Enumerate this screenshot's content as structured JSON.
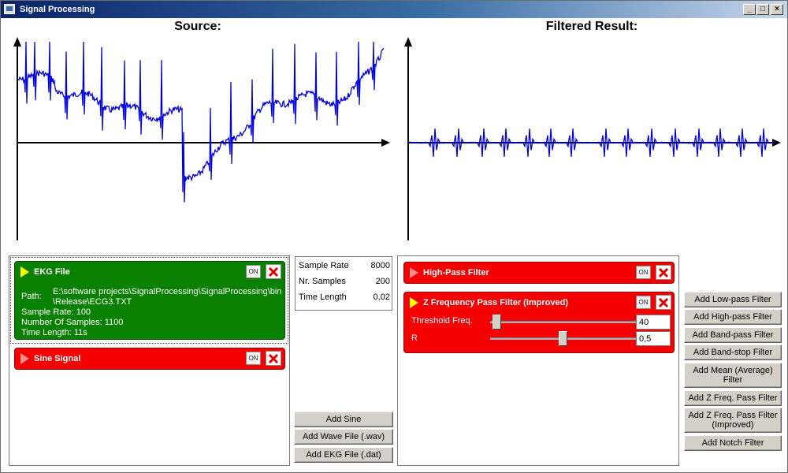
{
  "window": {
    "title": "Signal Processing",
    "minimize": "_",
    "maximize": "□",
    "close": "×"
  },
  "plots": {
    "source_title": "Source:",
    "result_title": "Filtered Result:"
  },
  "sources": [
    {
      "name": "EKG File",
      "state": "ON",
      "path_label": "Path:",
      "path_line1": "E:\\software projects\\SignalProcessing\\SignalProcessing\\bin",
      "path_line2": "\\Release\\ECG3.TXT",
      "sample_rate": "Sample Rate: 100",
      "num_samples": "Number Of Samples: 1100",
      "time_length": "Time Length: 11s",
      "color": "#0a8000"
    },
    {
      "name": "Sine Signal",
      "state": "ON",
      "color": "#f40000"
    }
  ],
  "stats": [
    {
      "label": "Sample Rate",
      "value": "8000"
    },
    {
      "label": "Nr. Samples",
      "value": "200"
    },
    {
      "label": "Time Length",
      "value": "0,02"
    }
  ],
  "source_buttons": [
    "Add Sine",
    "Add Wave File (.wav)",
    "Add EKG File (.dat)"
  ],
  "filters": [
    {
      "name": "High-Pass Filter",
      "state": "ON"
    },
    {
      "name": "Z Frequency Pass Filter (Improved)",
      "state": "ON",
      "params": [
        {
          "label": "Threshold Freq.",
          "value": "40",
          "slider_fraction": 0.02
        },
        {
          "label": "R",
          "value": "0,5",
          "slider_fraction": 0.5
        }
      ]
    }
  ],
  "filter_buttons": [
    "Add Low-pass Filter",
    "Add High-pass Filter",
    "Add Band-pass Filter",
    "Add Band-stop Filter",
    "Add Mean (Average) Filter",
    "Add Z Freq. Pass Filter",
    "Add Z Freq. Pass Filter (Improved)",
    "Add Notch Filter"
  ],
  "colors": {
    "signal_line": "#0000e0",
    "axis": "#000000",
    "on_card": "#0a8000",
    "off_card": "#f40000"
  }
}
